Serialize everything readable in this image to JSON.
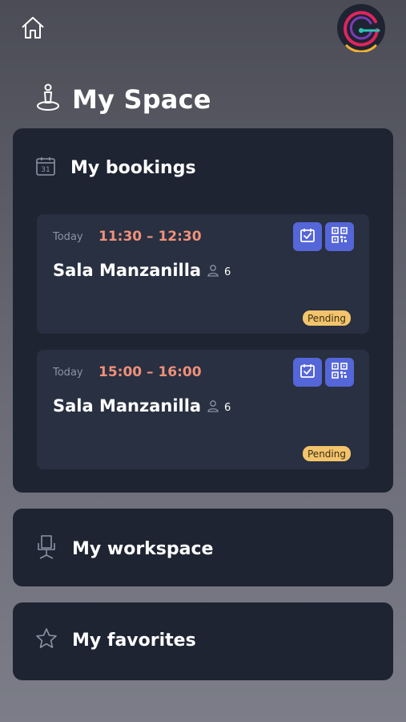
{
  "header": {
    "home_icon": "home-icon",
    "avatar_icon": "app-logo-avatar",
    "title": "My Space",
    "title_icon": "person-pin-icon"
  },
  "colors": {
    "background": "#5c5d67",
    "panel": "#1e2432",
    "card": "#283041",
    "time": "#f0907a",
    "action_button": "#5566d8",
    "badge": "#f3c46c"
  },
  "bookings": {
    "title": "My bookings",
    "icon": "calendar-31-icon",
    "items": [
      {
        "day": "Today",
        "time": "11:30 – 12:30",
        "room": "Sala Manzanilla",
        "capacity": "6",
        "status": "Pending"
      },
      {
        "day": "Today",
        "time": "15:00 – 16:00",
        "room": "Sala Manzanilla",
        "capacity": "6",
        "status": "Pending"
      }
    ]
  },
  "workspace": {
    "title": "My workspace",
    "icon": "office-chair-icon"
  },
  "favorites": {
    "title": "My favorites",
    "icon": "star-icon"
  }
}
